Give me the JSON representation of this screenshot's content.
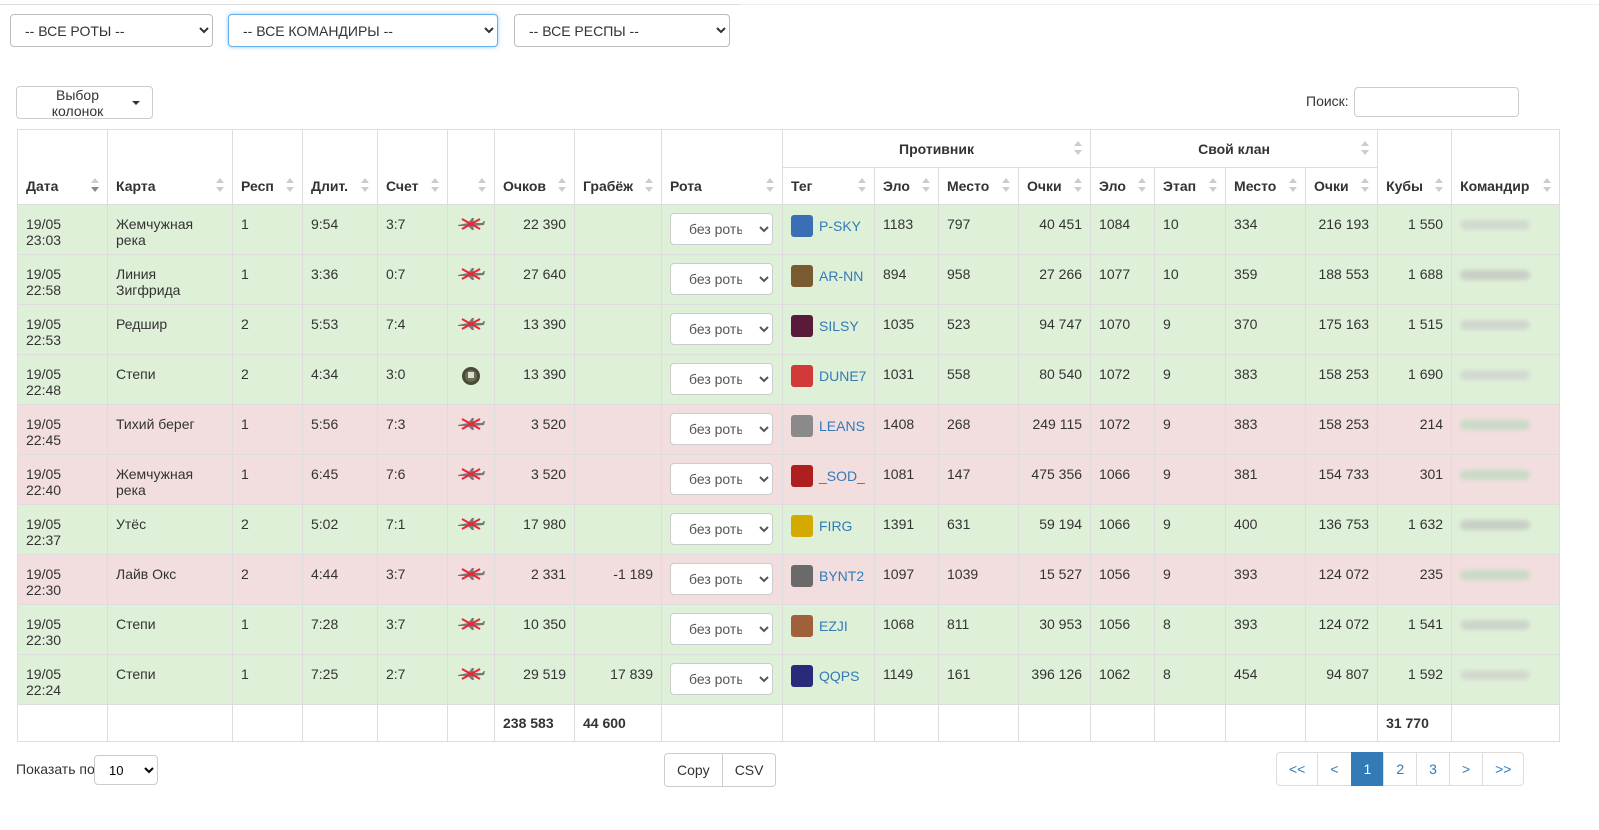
{
  "filters": {
    "companies": "-- ВСЕ РОТЫ --",
    "commanders": "-- ВСЕ КОМАНДИРЫ --",
    "respawns": "-- ВСЕ РЕСПЫ --"
  },
  "toolbar": {
    "columns_button": "Выбор колонок",
    "search_label": "Поиск:",
    "search_value": ""
  },
  "headers": {
    "date": "Дата",
    "map": "Карта",
    "resp": "Респ",
    "duration": "Длит.",
    "score": "Счет",
    "points": "Очков",
    "loot": "Грабёж",
    "company": "Рота",
    "opponent_group": "Противник",
    "tag": "Тег",
    "opp_elo": "Эло",
    "opp_place": "Место",
    "opp_points": "Очки",
    "own_group": "Свой клан",
    "own_elo": "Эло",
    "stage": "Этап",
    "own_place": "Место",
    "own_points": "Очки",
    "cubes": "Кубы",
    "commander": "Командир"
  },
  "rows": [
    {
      "result": "win",
      "date": "19/05 23:03",
      "map": "Жемчужная река",
      "resp": "1",
      "duration": "9:54",
      "score": "3:7",
      "mode_icon": "crossed-plane-icon",
      "points": "22 390",
      "loot": "",
      "company": "без роты",
      "tag": "P-SKY",
      "logo_color": "#3a6fb5",
      "opp_elo": "1183",
      "opp_place": "797",
      "opp_points": "40 451",
      "own_elo": "1084",
      "stage": "10",
      "own_place": "334",
      "own_points": "216 193",
      "cubes": "1 550",
      "commander_color": "#c8c8c8"
    },
    {
      "result": "win",
      "date": "19/05 22:58",
      "map": "Линия Зигфрида",
      "resp": "1",
      "duration": "3:36",
      "score": "0:7",
      "mode_icon": "crossed-plane-icon",
      "points": "27 640",
      "loot": "",
      "company": "без роты",
      "tag": "AR-NN",
      "logo_color": "#7a5a30",
      "opp_elo": "894",
      "opp_place": "958",
      "opp_points": "27 266",
      "own_elo": "1077",
      "stage": "10",
      "own_place": "359",
      "own_points": "188 553",
      "cubes": "1 688",
      "commander_color": "#b5b5b5"
    },
    {
      "result": "win",
      "date": "19/05 22:53",
      "map": "Редшир",
      "resp": "2",
      "duration": "5:53",
      "score": "7:4",
      "mode_icon": "crossed-plane-icon",
      "points": "13 390",
      "loot": "",
      "company": "без роты",
      "tag": "SILSY",
      "logo_color": "#5a1a3a",
      "opp_elo": "1035",
      "opp_place": "523",
      "opp_points": "94 747",
      "own_elo": "1070",
      "stage": "9",
      "own_place": "370",
      "own_points": "175 163",
      "cubes": "1 515",
      "commander_color": "#c4c4c4"
    },
    {
      "result": "win",
      "date": "19/05 22:48",
      "map": "Степи",
      "resp": "2",
      "duration": "4:34",
      "score": "3:0",
      "mode_icon": "flag-badge-icon",
      "points": "13 390",
      "loot": "",
      "company": "без роты",
      "tag": "DUNE7",
      "logo_color": "#d23a3a",
      "opp_elo": "1031",
      "opp_place": "558",
      "opp_points": "80 540",
      "own_elo": "1072",
      "stage": "9",
      "own_place": "383",
      "own_points": "158 253",
      "cubes": "1 690",
      "commander_color": "#c8c8c8"
    },
    {
      "result": "loss",
      "date": "19/05 22:45",
      "map": "Тихий берег",
      "resp": "1",
      "duration": "5:56",
      "score": "7:3",
      "mode_icon": "crossed-plane-icon",
      "points": "3 520",
      "loot": "",
      "company": "без роты",
      "tag": "LEANS",
      "logo_color": "#8a8a8a",
      "opp_elo": "1408",
      "opp_place": "268",
      "opp_points": "249 115",
      "own_elo": "1072",
      "stage": "9",
      "own_place": "383",
      "own_points": "158 253",
      "cubes": "214",
      "commander_color": "#a9d8b4"
    },
    {
      "result": "loss",
      "date": "19/05 22:40",
      "map": "Жемчужная река",
      "resp": "1",
      "duration": "6:45",
      "score": "7:6",
      "mode_icon": "crossed-plane-icon",
      "points": "3 520",
      "loot": "",
      "company": "без роты",
      "tag": "_SOD_",
      "logo_color": "#b01f1f",
      "opp_elo": "1081",
      "opp_place": "147",
      "opp_points": "475 356",
      "own_elo": "1066",
      "stage": "9",
      "own_place": "381",
      "own_points": "154 733",
      "cubes": "301",
      "commander_color": "#a9d8b4"
    },
    {
      "result": "win",
      "date": "19/05 22:37",
      "map": "Утёс",
      "resp": "2",
      "duration": "5:02",
      "score": "7:1",
      "mode_icon": "crossed-plane-icon",
      "points": "17 980",
      "loot": "",
      "company": "без роты",
      "tag": "FIRG",
      "logo_color": "#d4a900",
      "opp_elo": "1391",
      "opp_place": "631",
      "opp_points": "59 194",
      "own_elo": "1066",
      "stage": "9",
      "own_place": "400",
      "own_points": "136 753",
      "cubes": "1 632",
      "commander_color": "#b5b5b5"
    },
    {
      "result": "loss",
      "date": "19/05 22:30",
      "map": "Лайв Окс",
      "resp": "2",
      "duration": "4:44",
      "score": "3:7",
      "mode_icon": "crossed-plane-icon",
      "points": "2 331",
      "loot": "-1 189",
      "company": "без роты",
      "tag": "BYNT2",
      "logo_color": "#6a6a6a",
      "opp_elo": "1097",
      "opp_place": "1039",
      "opp_points": "15 527",
      "own_elo": "1056",
      "stage": "9",
      "own_place": "393",
      "own_points": "124 072",
      "cubes": "235",
      "commander_color": "#a9d8b4"
    },
    {
      "result": "win",
      "date": "19/05 22:30",
      "map": "Степи",
      "resp": "1",
      "duration": "7:28",
      "score": "3:7",
      "mode_icon": "crossed-plane-icon",
      "points": "10 350",
      "loot": "",
      "company": "без роты",
      "tag": "EZJI",
      "logo_color": "#a0603a",
      "opp_elo": "1068",
      "opp_place": "811",
      "opp_points": "30 953",
      "own_elo": "1056",
      "stage": "8",
      "own_place": "393",
      "own_points": "124 072",
      "cubes": "1 541",
      "commander_color": "#c0c0c0"
    },
    {
      "result": "win",
      "date": "19/05 22:24",
      "map": "Степи",
      "resp": "1",
      "duration": "7:25",
      "score": "2:7",
      "mode_icon": "crossed-plane-icon",
      "points": "29 519",
      "loot": "17 839",
      "company": "без роты",
      "tag": "QQPS",
      "logo_color": "#2a2a7a",
      "opp_elo": "1149",
      "opp_place": "161",
      "opp_points": "396 126",
      "own_elo": "1062",
      "stage": "8",
      "own_place": "454",
      "own_points": "94 807",
      "cubes": "1 592",
      "commander_color": "#c8c8c8"
    }
  ],
  "totals": {
    "points": "238 583",
    "loot": "44 600",
    "cubes": "31 770"
  },
  "footer": {
    "show_label": "Показать по",
    "page_size": "10",
    "copy": "Copy",
    "csv": "CSV",
    "pages": [
      "<<",
      "<",
      "1",
      "2",
      "3",
      ">",
      ">>"
    ],
    "active_page": "1"
  }
}
